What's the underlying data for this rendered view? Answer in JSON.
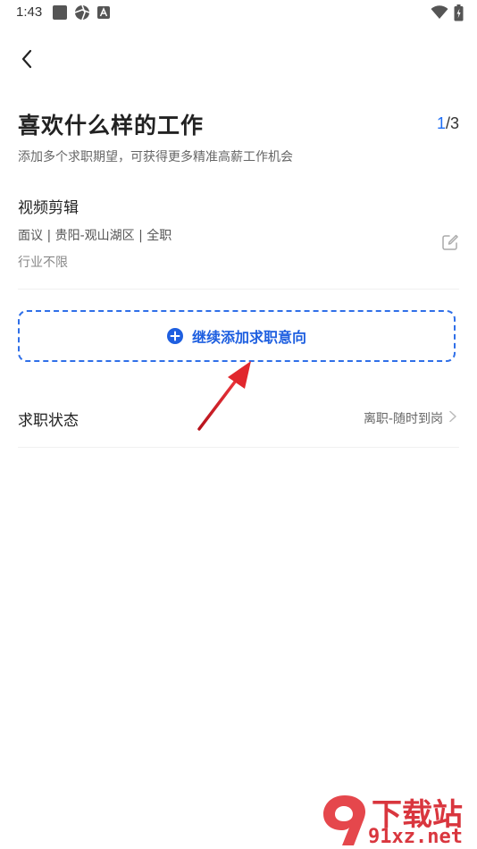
{
  "status_bar": {
    "time": "1:43"
  },
  "header": {
    "title": "喜欢什么样的工作",
    "step_current": "1",
    "step_total": "/3",
    "subtitle": "添加多个求职期望，可获得更多精准高薪工作机会"
  },
  "job_expectation": {
    "title": "视频剪辑",
    "details": "面议 | 贵阳-观山湖区 | 全职",
    "industry": "行业不限"
  },
  "add_button": {
    "label": "继续添加求职意向"
  },
  "job_status": {
    "label": "求职状态",
    "value": "离职-随时到岗"
  },
  "watermark": {
    "top_text": "下载站",
    "bottom_text": "91xz.net"
  },
  "colors": {
    "accent": "#1e6ef5",
    "annotation_arrow": "#d9252b"
  }
}
